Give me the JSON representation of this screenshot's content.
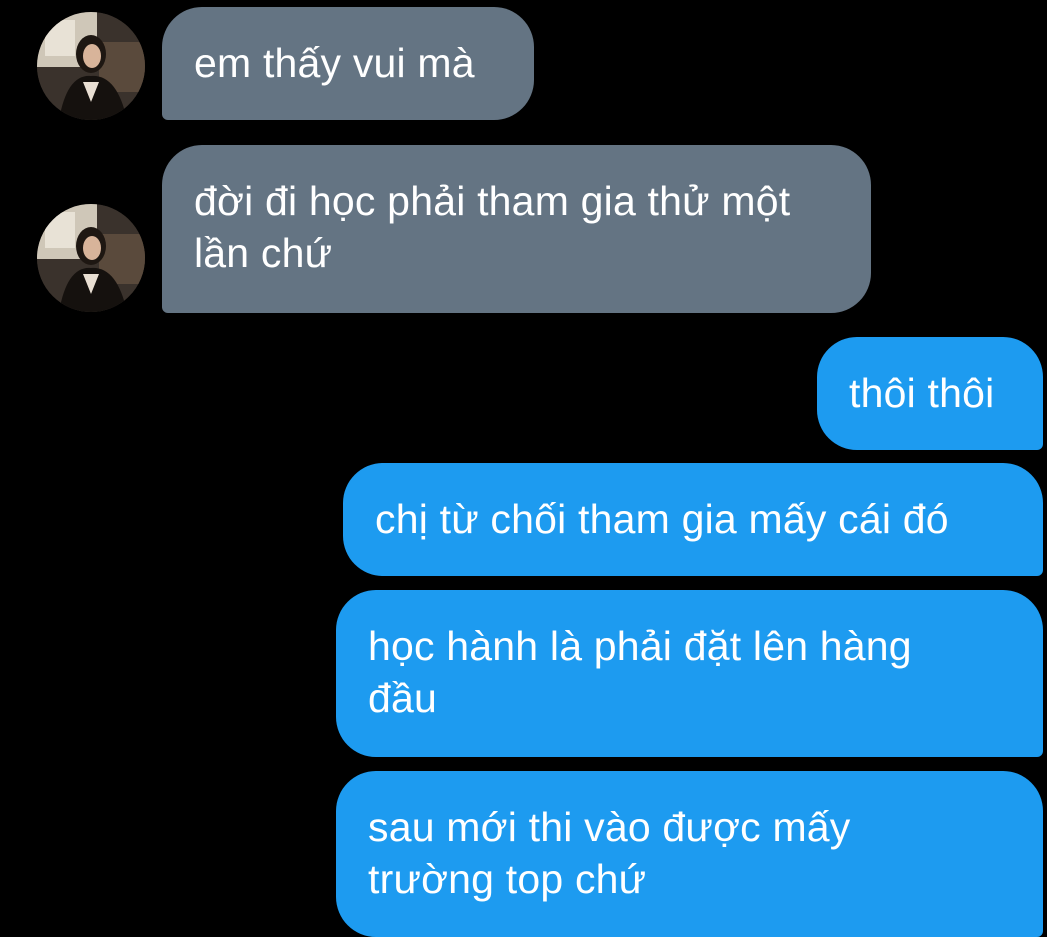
{
  "conversation": {
    "contact_avatar": "contact-photo",
    "colors": {
      "background": "#000000",
      "incoming_bubble": "#647483",
      "outgoing_bubble": "#1d9bf0",
      "text": "#ffffff"
    },
    "messages": [
      {
        "direction": "incoming",
        "text": "em thấy vui mà"
      },
      {
        "direction": "incoming",
        "text": "đời đi học phải tham gia thử một lần chứ"
      },
      {
        "direction": "outgoing",
        "text": "thôi thôi"
      },
      {
        "direction": "outgoing",
        "text": "chị từ chối tham gia mấy cái đó"
      },
      {
        "direction": "outgoing",
        "text": "học hành là phải đặt lên hàng đầu"
      },
      {
        "direction": "outgoing",
        "text": "sau mới thi vào được mấy trường top chứ"
      }
    ]
  }
}
